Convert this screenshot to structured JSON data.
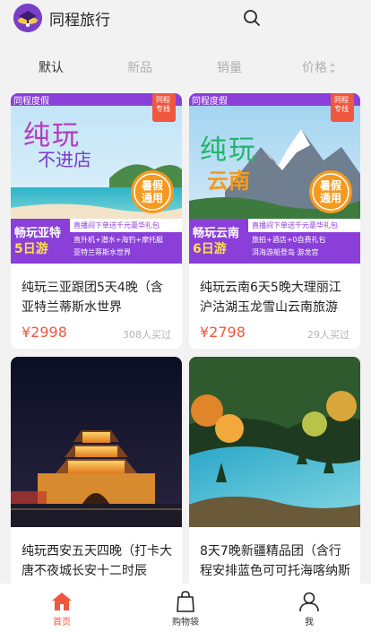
{
  "header": {
    "app_title": "同程旅行",
    "logo_icon": "tongcheng-logo-icon",
    "search_icon": "search-icon"
  },
  "sort_tabs": [
    {
      "label": "默认",
      "active": true
    },
    {
      "label": "新品",
      "active": false
    },
    {
      "label": "销量",
      "active": false
    },
    {
      "label": "价格",
      "active": false,
      "icon": "sort-arrows-icon"
    }
  ],
  "products": [
    {
      "title": "纯玩三亚跟团5天4晚（含亚特兰蒂斯水世界",
      "price": "¥2998",
      "sold": "308人买过",
      "poster": {
        "brand": "同程度假",
        "headline_1": "纯玩",
        "headline_2": "不进店",
        "badge": "暑假通用",
        "corner": "同程专线",
        "banner_title": "畅玩亚特",
        "banner_days": "5日游",
        "promo": "直播间下单送千元豪华礼包",
        "features_1": "直升机+潜水+海钓+摩托艇",
        "features_2": "亚特兰蒂斯水世界"
      }
    },
    {
      "title": "纯玩云南6天5晚大理丽江沪沽湖玉龙雪山云南旅游",
      "price": "¥2798",
      "sold": "29人买过",
      "poster": {
        "brand": "同程度假",
        "headline_1": "纯玩",
        "headline_2": "云南",
        "badge": "暑假通用",
        "corner": "同程专线",
        "banner_title": "畅玩云南",
        "banner_days": "6日游",
        "promo": "直播间下单送千元豪华礼包",
        "features_1": "旅拍+酒店+0自费礼包",
        "features_2": "洱海游船登岛 游龙宫"
      }
    },
    {
      "title": "纯玩西安五天四晚（打卡大唐不夜城长安十二时辰",
      "price": "",
      "sold": ""
    },
    {
      "title": "8天7晚新疆精品团（含行程安排蓝色可可托海喀纳斯",
      "price": "",
      "sold": ""
    }
  ],
  "tabbar": [
    {
      "label": "首页",
      "icon": "home-icon",
      "active": true
    },
    {
      "label": "购物袋",
      "icon": "shopping-bag-icon",
      "active": false
    },
    {
      "label": "我",
      "icon": "user-icon",
      "active": false
    }
  ],
  "colors": {
    "accent": "#f0573e",
    "background": "#f2f2f2",
    "inactive_text": "#b0b0b0",
    "poster_purple": "#8a3fd8",
    "poster_orange": "#f59a1f"
  }
}
